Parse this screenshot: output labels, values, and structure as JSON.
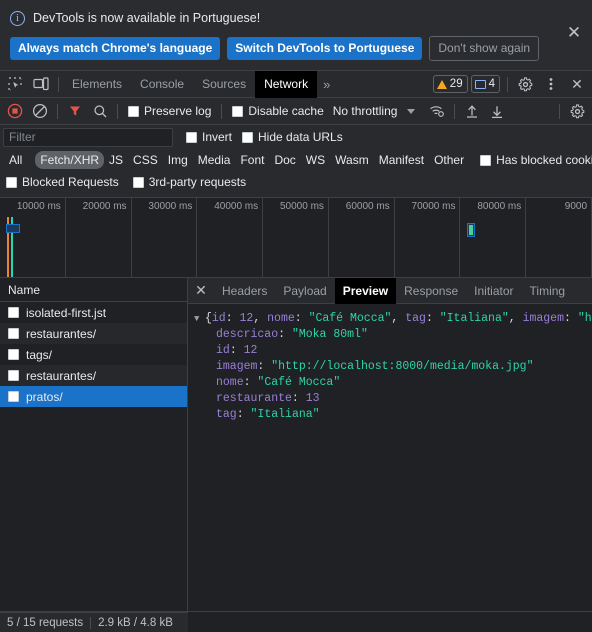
{
  "banner": {
    "icon": "info-icon",
    "message": "DevTools is now available in Portuguese!",
    "buttons": [
      {
        "label": "Always match Chrome's language",
        "style": "primary"
      },
      {
        "label": "Switch DevTools to Portuguese",
        "style": "primary"
      },
      {
        "label": "Don't show again",
        "style": "outline"
      }
    ],
    "close_label": "✕"
  },
  "tabstrip": {
    "icons": [
      "inspect-element-icon",
      "device-toolbar-icon"
    ],
    "tabs": [
      {
        "label": "Elements",
        "active": false
      },
      {
        "label": "Console",
        "active": false
      },
      {
        "label": "Sources",
        "active": false
      },
      {
        "label": "Network",
        "active": true
      }
    ],
    "more_label": "»",
    "warning_count": "29",
    "message_count": "4",
    "settings_icon": "gear-icon",
    "more_options_icon": "kebab-menu-icon",
    "close_icon": "close-icon",
    "close_label": "✕"
  },
  "network_toolbar": {
    "record_icon": "record-button-icon",
    "clear_icon": "clear-icon",
    "filter_icon": "filter-funnel-icon",
    "search_icon": "search-icon",
    "preserve_log_label": "Preserve log",
    "disable_cache_label": "Disable cache",
    "throttling_value": "No throttling",
    "wifi_icon": "network-conditions-icon",
    "import_icon": "import-har-icon",
    "export_icon": "export-har-icon",
    "settings_icon": "network-settings-gear-icon"
  },
  "filters": {
    "placeholder": "Filter",
    "value": "",
    "invert_label": "Invert",
    "hide_data_urls_label": "Hide data URLs",
    "types": [
      {
        "label": "All",
        "selected": false
      },
      {
        "label": "Fetch/XHR",
        "selected": true
      },
      {
        "label": "JS",
        "selected": false
      },
      {
        "label": "CSS",
        "selected": false
      },
      {
        "label": "Img",
        "selected": false
      },
      {
        "label": "Media",
        "selected": false
      },
      {
        "label": "Font",
        "selected": false
      },
      {
        "label": "Doc",
        "selected": false
      },
      {
        "label": "WS",
        "selected": false
      },
      {
        "label": "Wasm",
        "selected": false
      },
      {
        "label": "Manifest",
        "selected": false
      },
      {
        "label": "Other",
        "selected": false
      }
    ],
    "has_blocked_cookies_label": "Has blocked cookies",
    "blocked_requests_label": "Blocked Requests",
    "third_party_label": "3rd-party requests"
  },
  "overview": {
    "ticks": [
      "10000 ms",
      "20000 ms",
      "30000 ms",
      "40000 ms",
      "50000 ms",
      "60000 ms",
      "70000 ms",
      "80000 ms",
      "9000"
    ],
    "markers": {
      "dom_content_loaded_color": "#e8833a",
      "load_color": "#2dd4aa",
      "request_bar_color": "#4ecf8f",
      "request_box_color": "#1a73c8"
    }
  },
  "requests": {
    "column_header": "Name",
    "rows": [
      {
        "name": "isolated-first.jst",
        "selected": false
      },
      {
        "name": "restaurantes/",
        "selected": false
      },
      {
        "name": "tags/",
        "selected": false
      },
      {
        "name": "restaurantes/",
        "selected": false
      },
      {
        "name": "pratos/",
        "selected": true
      }
    ]
  },
  "detail": {
    "close_label": "✕",
    "tabs": [
      {
        "label": "Headers",
        "active": false
      },
      {
        "label": "Payload",
        "active": false
      },
      {
        "label": "Preview",
        "active": true
      },
      {
        "label": "Response",
        "active": false
      },
      {
        "label": "Initiator",
        "active": false
      },
      {
        "label": "Timing",
        "active": false
      }
    ],
    "preview": {
      "summary": {
        "open_brace": "{",
        "parts": [
          {
            "key": "id",
            "sep": ": ",
            "value": "12",
            "type": "number"
          },
          {
            "key": "nome",
            "sep": ": ",
            "value": "\"Café Mocca\"",
            "type": "string"
          },
          {
            "key": "tag",
            "sep": ": ",
            "value": "\"Italiana\"",
            "type": "string"
          },
          {
            "key": "imagem",
            "sep": ": ",
            "value": "\"htt",
            "type": "string"
          }
        ]
      },
      "properties": [
        {
          "key": "descricao",
          "value": "\"Moka 80ml\"",
          "type": "string"
        },
        {
          "key": "id",
          "value": "12",
          "type": "number"
        },
        {
          "key": "imagem",
          "value": "\"http://localhost:8000/media/moka.jpg\"",
          "type": "string"
        },
        {
          "key": "nome",
          "value": "\"Café Mocca\"",
          "type": "string"
        },
        {
          "key": "restaurante",
          "value": "13",
          "type": "number"
        },
        {
          "key": "tag",
          "value": "\"Italiana\"",
          "type": "string"
        }
      ]
    }
  },
  "statusbar": {
    "requests_text": "5 / 15 requests",
    "transfer_text": "2.9 kB / 4.8 kB"
  },
  "colors": {
    "accent": "#1a73c8",
    "warning": "#f5a623",
    "string": "#2dd4aa",
    "key": "#9a7fd8",
    "background": "#202124",
    "toolbar": "#292a2d"
  }
}
